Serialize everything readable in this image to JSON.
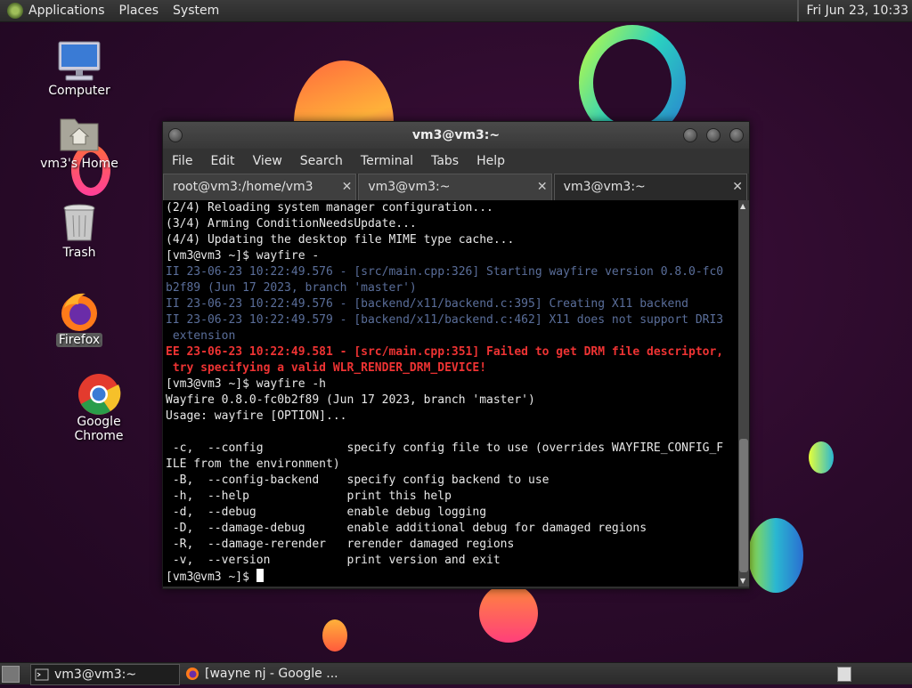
{
  "top_panel": {
    "menus": [
      "Applications",
      "Places",
      "System"
    ],
    "clock": "Fri Jun 23, 10:33"
  },
  "desktop_icons": [
    {
      "label": "Computer",
      "icon": "computer-icon"
    },
    {
      "label": "vm3's Home",
      "icon": "home-folder-icon"
    },
    {
      "label": "Trash",
      "icon": "trash-icon"
    },
    {
      "label": "Firefox",
      "icon": "firefox-icon",
      "selected": true
    },
    {
      "label": "Google Chrome",
      "icon": "chrome-icon"
    }
  ],
  "window": {
    "title": "vm3@vm3:~",
    "menu": [
      "File",
      "Edit",
      "View",
      "Search",
      "Terminal",
      "Tabs",
      "Help"
    ],
    "tabs": [
      {
        "label": "root@vm3:/home/vm3",
        "active": false
      },
      {
        "label": "vm3@vm3:~",
        "active": false
      },
      {
        "label": "vm3@vm3:~",
        "active": true
      }
    ],
    "close_glyph": "✕",
    "terminal_lines": [
      {
        "text": "(2/4) Reloading system manager configuration...",
        "kind": "normal"
      },
      {
        "text": "(3/4) Arming ConditionNeedsUpdate...",
        "kind": "normal"
      },
      {
        "text": "(4/4) Updating the desktop file MIME type cache...",
        "kind": "normal"
      },
      {
        "text": "[vm3@vm3 ~]$ wayfire -",
        "kind": "normal"
      },
      {
        "text": "II 23-06-23 10:22:49.576 - [src/main.cpp:326] Starting wayfire version 0.8.0-fc0",
        "kind": "log"
      },
      {
        "text": "b2f89 (Jun 17 2023, branch 'master')",
        "kind": "log"
      },
      {
        "text": "II 23-06-23 10:22:49.576 - [backend/x11/backend.c:395] Creating X11 backend",
        "kind": "log"
      },
      {
        "text": "II 23-06-23 10:22:49.579 - [backend/x11/backend.c:462] X11 does not support DRI3",
        "kind": "log"
      },
      {
        "text": " extension",
        "kind": "log"
      },
      {
        "text": "EE 23-06-23 10:22:49.581 - [src/main.cpp:351] Failed to get DRM file descriptor,",
        "kind": "err"
      },
      {
        "text": " try specifying a valid WLR_RENDER_DRM_DEVICE!",
        "kind": "err"
      },
      {
        "text": "[vm3@vm3 ~]$ wayfire -h",
        "kind": "normal"
      },
      {
        "text": "Wayfire 0.8.0-fc0b2f89 (Jun 17 2023, branch 'master')",
        "kind": "normal"
      },
      {
        "text": "Usage: wayfire [OPTION]...",
        "kind": "normal"
      },
      {
        "text": "",
        "kind": "normal"
      },
      {
        "text": " -c,  --config            specify config file to use (overrides WAYFIRE_CONFIG_F",
        "kind": "normal"
      },
      {
        "text": "ILE from the environment)",
        "kind": "normal"
      },
      {
        "text": " -B,  --config-backend    specify config backend to use",
        "kind": "normal"
      },
      {
        "text": " -h,  --help              print this help",
        "kind": "normal"
      },
      {
        "text": " -d,  --debug             enable debug logging",
        "kind": "normal"
      },
      {
        "text": " -D,  --damage-debug      enable additional debug for damaged regions",
        "kind": "normal"
      },
      {
        "text": " -R,  --damage-rerender   rerender damaged regions",
        "kind": "normal"
      },
      {
        "text": " -v,  --version           print version and exit",
        "kind": "normal"
      }
    ],
    "prompt": "[vm3@vm3 ~]$ "
  },
  "bottom_panel": {
    "tasks": [
      {
        "label": "vm3@vm3:~",
        "icon": "terminal-icon",
        "active": true
      },
      {
        "label": "[wayne nj - Google ...",
        "icon": "firefox-icon",
        "active": false
      }
    ]
  }
}
